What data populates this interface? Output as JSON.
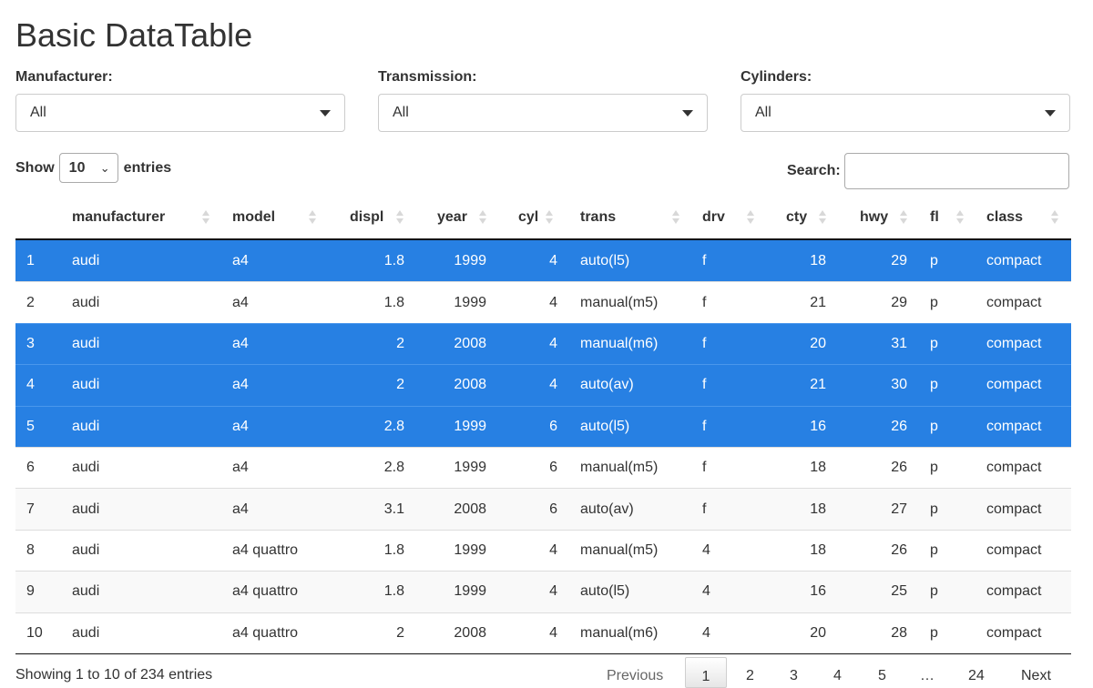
{
  "page": {
    "title": "Basic DataTable"
  },
  "filters": [
    {
      "label": "Manufacturer:",
      "value": "All"
    },
    {
      "label": "Transmission:",
      "value": "All"
    },
    {
      "label": "Cylinders:",
      "value": "All"
    }
  ],
  "length": {
    "prefix": "Show",
    "value": "10",
    "suffix": "entries"
  },
  "search": {
    "label": "Search:",
    "value": ""
  },
  "columns": [
    "manufacturer",
    "model",
    "displ",
    "year",
    "cyl",
    "trans",
    "drv",
    "cty",
    "hwy",
    "fl",
    "class"
  ],
  "rows": [
    {
      "idx": "1",
      "selected": true,
      "cells": [
        "audi",
        "a4",
        "1.8",
        "1999",
        "4",
        "auto(l5)",
        "f",
        "18",
        "29",
        "p",
        "compact"
      ]
    },
    {
      "idx": "2",
      "selected": false,
      "cells": [
        "audi",
        "a4",
        "1.8",
        "1999",
        "4",
        "manual(m5)",
        "f",
        "21",
        "29",
        "p",
        "compact"
      ]
    },
    {
      "idx": "3",
      "selected": true,
      "cells": [
        "audi",
        "a4",
        "2",
        "2008",
        "4",
        "manual(m6)",
        "f",
        "20",
        "31",
        "p",
        "compact"
      ]
    },
    {
      "idx": "4",
      "selected": true,
      "cells": [
        "audi",
        "a4",
        "2",
        "2008",
        "4",
        "auto(av)",
        "f",
        "21",
        "30",
        "p",
        "compact"
      ]
    },
    {
      "idx": "5",
      "selected": true,
      "cells": [
        "audi",
        "a4",
        "2.8",
        "1999",
        "6",
        "auto(l5)",
        "f",
        "16",
        "26",
        "p",
        "compact"
      ]
    },
    {
      "idx": "6",
      "selected": false,
      "cells": [
        "audi",
        "a4",
        "2.8",
        "1999",
        "6",
        "manual(m5)",
        "f",
        "18",
        "26",
        "p",
        "compact"
      ]
    },
    {
      "idx": "7",
      "selected": false,
      "cells": [
        "audi",
        "a4",
        "3.1",
        "2008",
        "6",
        "auto(av)",
        "f",
        "18",
        "27",
        "p",
        "compact"
      ]
    },
    {
      "idx": "8",
      "selected": false,
      "cells": [
        "audi",
        "a4 quattro",
        "1.8",
        "1999",
        "4",
        "manual(m5)",
        "4",
        "18",
        "26",
        "p",
        "compact"
      ]
    },
    {
      "idx": "9",
      "selected": false,
      "cells": [
        "audi",
        "a4 quattro",
        "1.8",
        "1999",
        "4",
        "auto(l5)",
        "4",
        "16",
        "25",
        "p",
        "compact"
      ]
    },
    {
      "idx": "10",
      "selected": false,
      "cells": [
        "audi",
        "a4 quattro",
        "2",
        "2008",
        "4",
        "manual(m6)",
        "4",
        "20",
        "28",
        "p",
        "compact"
      ]
    }
  ],
  "info": "Showing 1 to 10 of 234 entries",
  "pagination": {
    "previous": "Previous",
    "pages": [
      "1",
      "2",
      "3",
      "4",
      "5",
      "…",
      "24"
    ],
    "current": "1",
    "next": "Next"
  },
  "colors": {
    "selected_row": "#2780e3",
    "stripe": "#f9f9f9"
  },
  "icons": {
    "dropdown": "caret-down-icon",
    "sort": "sort-both-icon"
  }
}
